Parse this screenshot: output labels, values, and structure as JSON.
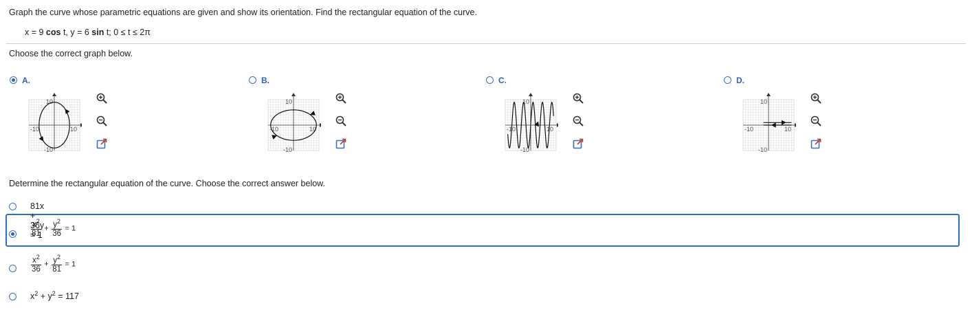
{
  "question": {
    "prompt": "Graph the curve whose parametric equations are given and show its orientation. Find the rectangular equation of the curve.",
    "eq_x_pre": "x = 9 ",
    "eq_x_fn": "cos",
    "eq_x_post": " t, y = 6 ",
    "eq_y_fn": "sin",
    "eq_y_post": " t;  0 ≤ t ≤ 2π"
  },
  "part1": {
    "instruction": "Choose the correct graph below.",
    "selected": "A",
    "options": [
      {
        "letter": "A.",
        "tick_pos": "10",
        "tick_neg": "-10",
        "tick_top": "10",
        "tick_bottom": "-10"
      },
      {
        "letter": "B.",
        "tick_pos": "10",
        "tick_neg": "-10",
        "tick_top": "10",
        "tick_bottom": "-10"
      },
      {
        "letter": "C.",
        "tick_pos": "10",
        "tick_neg": "-10",
        "tick_top": "10",
        "tick_bottom": "-10"
      },
      {
        "letter": "D.",
        "tick_pos": "10",
        "tick_neg": "-10",
        "tick_top": "10",
        "tick_bottom": "-10"
      }
    ],
    "tools": [
      "zoom-in-icon",
      "zoom-out-icon",
      "expand-icon"
    ]
  },
  "part2": {
    "instruction": "Determine the rectangular equation of the curve. Choose the correct answer below.",
    "selected_index": 1,
    "a1": "81x + 36y = 1",
    "a2": {
      "n1": "x",
      "n2": "y",
      "d1": "81",
      "d2": "36",
      "plus": "+",
      "rhs": "= 1"
    },
    "a3": {
      "n1": "x",
      "n2": "y",
      "d1": "36",
      "d2": "81",
      "plus": "+",
      "rhs": "= 1"
    },
    "a4": {
      "t1": "x",
      "plus": " + ",
      "t2": "y",
      "rhs": " = 117"
    },
    "exp": "2"
  },
  "colors": {
    "accent": "#2f5fbf",
    "selection_border": "#2a6fc9"
  }
}
